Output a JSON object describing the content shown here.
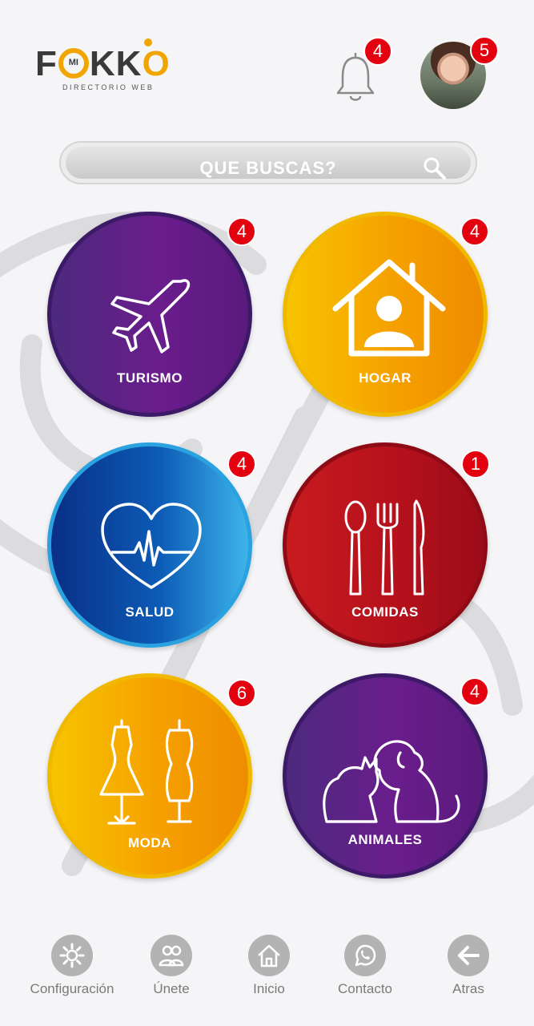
{
  "app": {
    "logo_small": "MI",
    "logo_subtitle": "DIRECTORIO WEB",
    "brand_color": "#f0a500"
  },
  "header": {
    "notifications_count": "4",
    "profile_count": "5"
  },
  "search": {
    "placeholder": "QUE BUSCAS?"
  },
  "categories": [
    {
      "label": "TURISMO",
      "badge": "4",
      "icon": "airplane-icon",
      "color": "purple"
    },
    {
      "label": "HOGAR",
      "badge": "4",
      "icon": "house-user-icon",
      "color": "orange"
    },
    {
      "label": "SALUD",
      "badge": "4",
      "icon": "heart-pulse-icon",
      "color": "blue"
    },
    {
      "label": "COMIDAS",
      "badge": "1",
      "icon": "cutlery-icon",
      "color": "red"
    },
    {
      "label": "MODA",
      "badge": "6",
      "icon": "dress-mannequin-icon",
      "color": "orange"
    },
    {
      "label": "ANIMALES",
      "badge": "4",
      "icon": "cat-dog-icon",
      "color": "purple"
    }
  ],
  "nav": [
    {
      "label": "Configuración",
      "icon": "gear-icon"
    },
    {
      "label": "Únete",
      "icon": "users-icon"
    },
    {
      "label": "Inicio",
      "icon": "home-icon"
    },
    {
      "label": "Contacto",
      "icon": "whatsapp-icon"
    },
    {
      "label": "Atras",
      "icon": "arrow-left-icon"
    }
  ],
  "colors": {
    "badge": "#e3000f",
    "purple": "#5b1f85",
    "orange": "#f5a000",
    "blue": "#0c5bb6",
    "red": "#b6111c"
  }
}
